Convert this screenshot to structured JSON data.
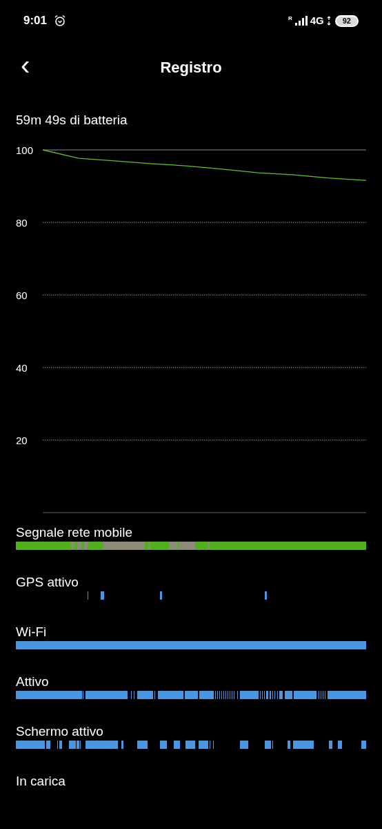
{
  "status_bar": {
    "time": "9:01",
    "roaming": "R",
    "network": "4G",
    "battery": "92"
  },
  "header": {
    "back": "‹",
    "title": "Registro"
  },
  "summary": "59m 49s di batteria",
  "chart_data": {
    "type": "line",
    "categories": [
      null,
      null,
      null,
      null,
      null,
      null,
      null,
      null,
      null,
      null
    ],
    "ylim": [
      0,
      100
    ],
    "grid": true,
    "yticks": [
      20,
      40,
      60,
      80,
      100
    ],
    "series": [
      {
        "color": "#5fbf2a",
        "values": [
          100,
          97.7,
          97,
          96.2,
          95.6,
          94.7,
          93.7,
          93.1,
          92.2,
          91.6
        ]
      }
    ]
  },
  "tracks": [
    {
      "label": "Segnale rete mobile",
      "kind": "signal"
    },
    {
      "label": "GPS attivo",
      "kind": "gps"
    },
    {
      "label": "Wi-Fi",
      "kind": "wifi"
    },
    {
      "label": "Attivo",
      "kind": "awake"
    },
    {
      "label": "Schermo attivo",
      "kind": "screen"
    },
    {
      "label": "In carica",
      "kind": "charging"
    }
  ]
}
